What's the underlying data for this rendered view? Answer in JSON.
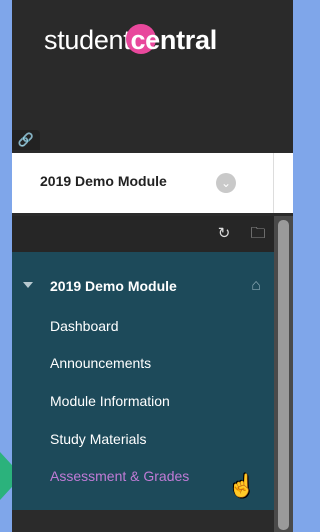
{
  "logo": {
    "student": "student",
    "central": "central"
  },
  "header": {
    "link_icon": "link-icon"
  },
  "module_bar": {
    "title": "2019 Demo Module",
    "chevron_icon": "chevron-down-icon"
  },
  "toolbar": {
    "refresh_icon": "refresh-icon",
    "folder_icon": "folder-icon"
  },
  "nav": {
    "title": "2019 Demo Module",
    "items": [
      {
        "label": "Dashboard",
        "active": false
      },
      {
        "label": "Announcements",
        "active": false
      },
      {
        "label": "Module Information",
        "active": false
      },
      {
        "label": "Study Materials",
        "active": false
      },
      {
        "label": "Assessment & Grades",
        "active": true
      }
    ]
  },
  "colors": {
    "page_bg": "#7fa6ea",
    "dark_bg": "#2b2b2b",
    "nav_bg": "#1d4a5a",
    "active_item": "#c07bd6",
    "logo_accent": "#e8489c",
    "indicator": "#2bb27c"
  }
}
